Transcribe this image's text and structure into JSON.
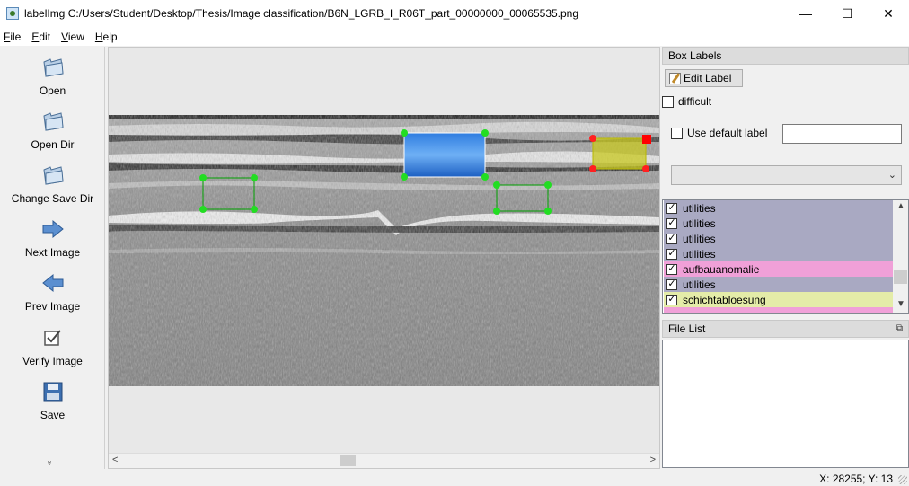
{
  "window": {
    "title": "labelImg C:/Users/Student/Desktop/Thesis/Image classification/B6N_LGRB_I_R06T_part_00000000_00065535.png",
    "minimize": "—",
    "maximize": "☐",
    "close": "✕"
  },
  "menu": {
    "items": [
      {
        "underline": "F",
        "rest": "ile"
      },
      {
        "underline": "E",
        "rest": "dit"
      },
      {
        "underline": "V",
        "rest": "iew"
      },
      {
        "underline": "H",
        "rest": "elp"
      }
    ]
  },
  "toolbar": {
    "open": "Open",
    "open_dir": "Open Dir",
    "change_save_dir": "Change Save Dir",
    "next_image": "Next Image",
    "prev_image": "Prev Image",
    "verify_image": "Verify Image",
    "save": "Save",
    "more": "»"
  },
  "box_labels": {
    "header": "Box Labels",
    "edit_label": "Edit Label",
    "difficult": "difficult",
    "use_default_label": "Use default label",
    "default_label_value": "",
    "items": [
      {
        "label": "utilities",
        "checked": true,
        "color": "#a9a9c2"
      },
      {
        "label": "utilities",
        "checked": true,
        "color": "#a9a9c2"
      },
      {
        "label": "utilities",
        "checked": true,
        "color": "#a9a9c2"
      },
      {
        "label": "utilities",
        "checked": true,
        "color": "#a9a9c2"
      },
      {
        "label": "aufbauanomalie",
        "checked": true,
        "color": "#f0a0d8"
      },
      {
        "label": "utilities",
        "checked": true,
        "color": "#a9a9c2"
      },
      {
        "label": "schichtabloesung",
        "checked": true,
        "color": "#e4eca8"
      }
    ]
  },
  "file_list": {
    "header": "File List"
  },
  "status": {
    "coords": "X: 28255; Y: 13"
  },
  "colors": {
    "selected_box": "#1f6fd6",
    "utilities_box": "#00c000",
    "schicht_box": "#b8b800",
    "handle_red": "#ff0000"
  }
}
